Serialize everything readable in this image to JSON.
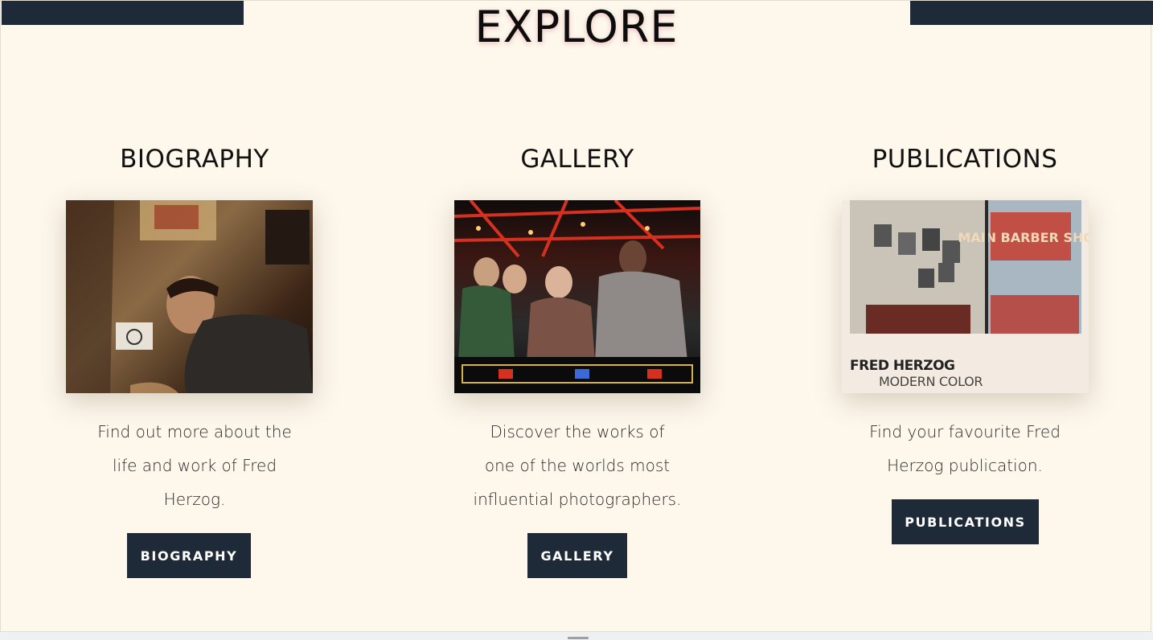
{
  "page": {
    "title": "EXPLORE"
  },
  "sections": [
    {
      "title": "BIOGRAPHY",
      "image_alt": "Fred Herzog working at a desk",
      "description_lines": [
        "Find out more about the",
        "life and work of Fred",
        "Herzog."
      ],
      "button": "BIOGRAPHY"
    },
    {
      "title": "GALLERY",
      "image_alt": "Crowd watching a game at a fair",
      "description_lines": [
        "Discover the works of",
        "one of the worlds most",
        "influential photographers."
      ],
      "button": "GALLERY"
    },
    {
      "title": "PUBLICATIONS",
      "image_alt": "Fred Herzog Modern Color book cover",
      "cover_title": "FRED HERZOG",
      "cover_subtitle": "MODERN COLOR",
      "cover_sign": "MAIN BARBER SHOP",
      "description_lines": [
        "Find your favourite Fred",
        "Herzog publication."
      ],
      "button": "PUBLICATIONS"
    }
  ],
  "colors": {
    "background": "#fdf7ec",
    "accent": "#1f2a38"
  }
}
